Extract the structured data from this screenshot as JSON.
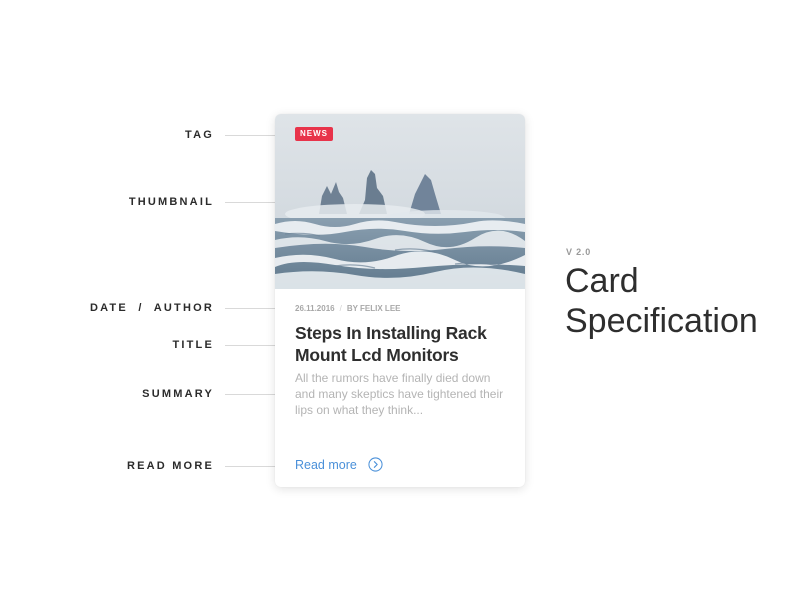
{
  "callouts": [
    {
      "id": "tag",
      "label": "TAG"
    },
    {
      "id": "thumbnail",
      "label": "THUMBNAIL"
    },
    {
      "id": "date-author",
      "label": "DATE  /  AUTHOR"
    },
    {
      "id": "title",
      "label": "TITLE"
    },
    {
      "id": "summary",
      "label": "SUMMARY"
    },
    {
      "id": "read-more",
      "label": "READ MORE"
    }
  ],
  "card": {
    "tag": "NEWS",
    "date": "26.11.2016",
    "meta_separator": "/",
    "author": "BY FELIX LEE",
    "title": "Steps In Installing Rack Mount Lcd Monitors",
    "summary": "All the rumors have finally died down and many skeptics have tightened their lips on what they think...",
    "read_more": "Read more",
    "read_more_icon": "chevron-circle-right-icon",
    "thumbnail_subject": "sea stacks and crashing waves"
  },
  "heading": {
    "version": "V 2.0",
    "title": "Card Specification"
  },
  "colors": {
    "tag_background": "#e8334a",
    "link": "#4a90d9",
    "label_text": "#2b2b2b",
    "leader_line": "#d9d9d9",
    "summary_text": "#b4b4b4"
  }
}
